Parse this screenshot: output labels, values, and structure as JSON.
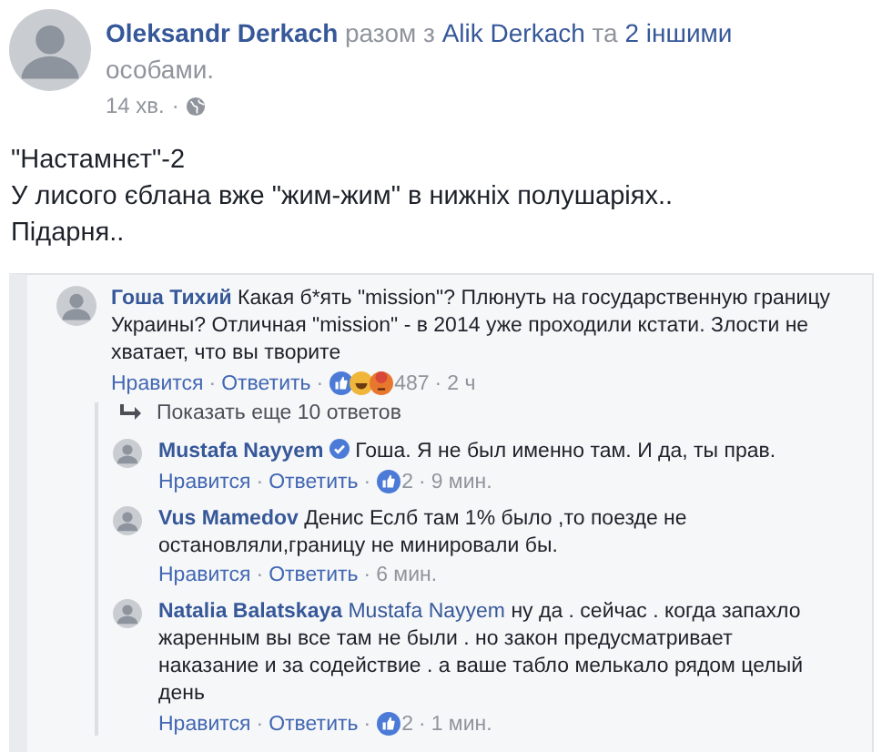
{
  "post": {
    "author": "Oleksandr Derkach",
    "with_text": "разом з",
    "tagged": "Alik Derkach",
    "and_text": "та",
    "others": "2 іншими",
    "others_rest": "особами.",
    "time": "14 хв.",
    "separator": "·",
    "lines": [
      "\"Настамнєт\"-2",
      "У лисого єблана вже \"жим-жим\" в нижніх полушаріях..",
      "Підарня.."
    ]
  },
  "screenshot": {
    "separator": "·",
    "comment": {
      "author": "Гоша Тихий",
      "verified": false,
      "text": "Какая б*ять \"mission\"? Плюнуть на государственную границу Украины? Отличная \"mission\" - в 2014 уже проходили кстати. Злости не хватает, что вы творите",
      "actions": [
        "Нравится",
        "Ответить"
      ],
      "reactions": [
        {
          "kind": "like"
        },
        {
          "kind": "haha"
        },
        {
          "kind": "angry"
        }
      ],
      "count": "487",
      "time": "2 ч"
    },
    "more_replies": "Показать еще 10 ответов",
    "replies": [
      {
        "author": "Mustafa Nayyem",
        "verified": true,
        "text": "Гоша. Я не был именно там. И да, ты прав.",
        "actions": [
          "Нравится",
          "Ответить"
        ],
        "reactions": [
          {
            "kind": "like"
          }
        ],
        "count": "2",
        "time": "9 мин."
      },
      {
        "author": "Vus Mamedov",
        "verified": false,
        "text": "Денис Еслб там 1% было ,то поезде не остановляли,границу не минировали бы.",
        "actions": [
          "Нравится",
          "Ответить"
        ],
        "time": "6 мин."
      },
      {
        "author": "Natalia Balatskaya",
        "verified": false,
        "mention": "Mustafa Nayyem",
        "text": "ну да . сейчас . когда запахло жаренным вы все там не были . но закон предусматривает наказание и за содействие . а ваше табло мелькало рядом целый день",
        "actions": [
          "Нравится",
          "Ответить"
        ],
        "reactions": [
          {
            "kind": "like"
          }
        ],
        "count": "2",
        "time": "1 мин."
      }
    ]
  }
}
